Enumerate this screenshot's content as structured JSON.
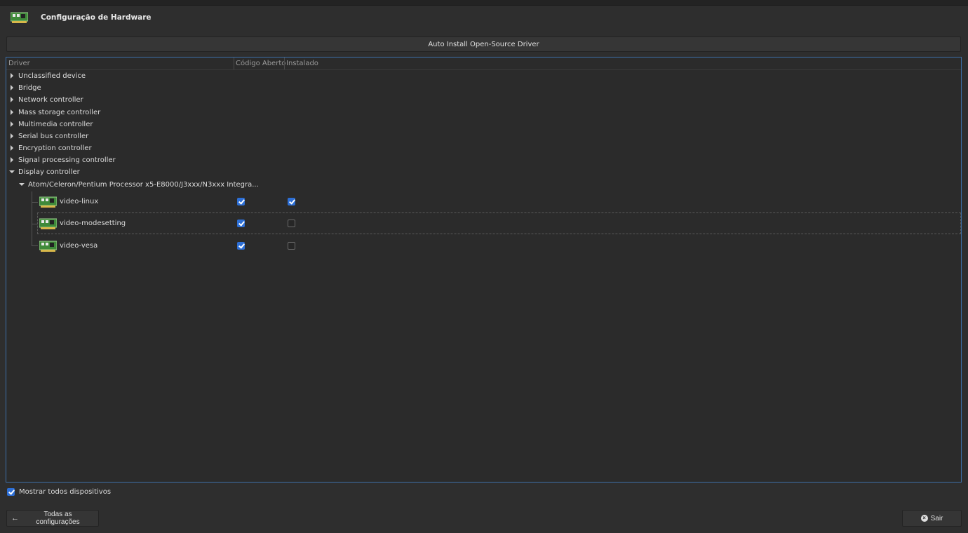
{
  "window": {
    "title": "Configuração de Hardware",
    "icon": "pci-card-icon"
  },
  "toolbar": {
    "auto_install_label": "Auto Install Open-Source Driver"
  },
  "tree": {
    "columns": [
      "Driver",
      "Código Aberto",
      "Instalado"
    ],
    "categories": [
      {
        "label": "Unclassified device",
        "expanded": false
      },
      {
        "label": "Bridge",
        "expanded": false
      },
      {
        "label": "Network controller",
        "expanded": false
      },
      {
        "label": "Mass storage controller",
        "expanded": false
      },
      {
        "label": "Multimedia controller",
        "expanded": false
      },
      {
        "label": "Serial bus controller",
        "expanded": false
      },
      {
        "label": "Encryption controller",
        "expanded": false
      },
      {
        "label": "Signal processing controller",
        "expanded": false
      },
      {
        "label": "Display controller",
        "expanded": true
      }
    ],
    "device": {
      "label": "Atom/Celeron/Pentium Processor x5-E8000/J3xxx/N3xxx Integra...",
      "expanded": true
    },
    "drivers": [
      {
        "name": "video-linux",
        "open_source": true,
        "installed": true
      },
      {
        "name": "video-modesetting",
        "open_source": true,
        "installed": false
      },
      {
        "name": "video-vesa",
        "open_source": true,
        "installed": false
      }
    ]
  },
  "footer": {
    "show_all_label": "Mostrar todos dispositivos",
    "show_all_checked": true,
    "back_label": "Todas as configurações",
    "quit_label": "Sair"
  },
  "colors": {
    "accent": "#2d6fd6",
    "background": "#2e2e2e",
    "focus_border": "#3d6fa8"
  }
}
